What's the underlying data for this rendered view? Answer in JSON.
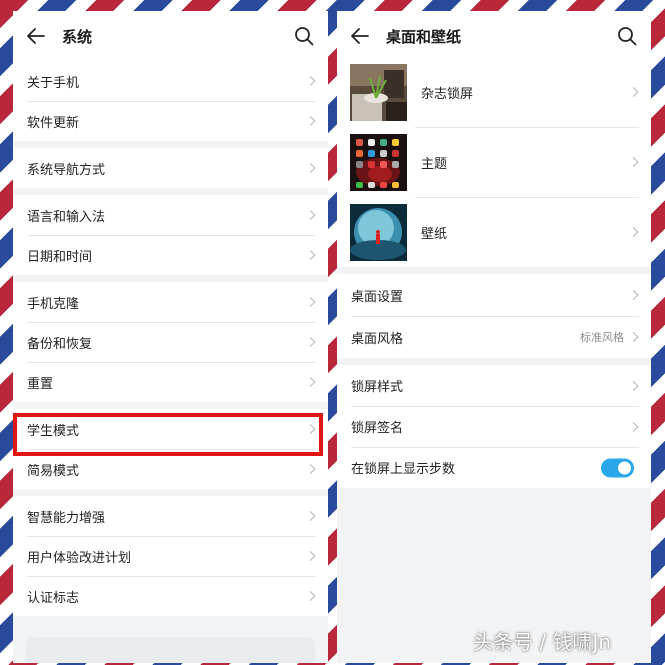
{
  "left": {
    "title": "系统",
    "groups": [
      [
        "关于手机",
        "软件更新"
      ],
      [
        "系统导航方式"
      ],
      [
        "语言和输入法",
        "日期和时间"
      ],
      [
        "手机克隆",
        "备份和恢复",
        "重置"
      ],
      [
        "学生模式",
        "简易模式"
      ],
      [
        "智慧能力增强",
        "用户体验改进计划",
        "认证标志"
      ]
    ]
  },
  "right": {
    "title": "桌面和壁纸",
    "themes": [
      {
        "label": "杂志锁屏"
      },
      {
        "label": "主题"
      },
      {
        "label": "壁纸"
      }
    ],
    "desktop": [
      {
        "label": "桌面设置"
      },
      {
        "label": "桌面风格",
        "value": "标准风格"
      }
    ],
    "lock": [
      {
        "label": "锁屏样式"
      },
      {
        "label": "锁屏签名"
      },
      {
        "label": "在锁屏上显示步数",
        "toggle_on": true
      }
    ]
  },
  "watermark": "头条号 / 钱啸Jn",
  "colors": {
    "highlight": "#e21515",
    "toggle": "#2aa7ea"
  },
  "icons": [
    "back-arrow-icon",
    "search-icon",
    "chevron-right-icon"
  ]
}
